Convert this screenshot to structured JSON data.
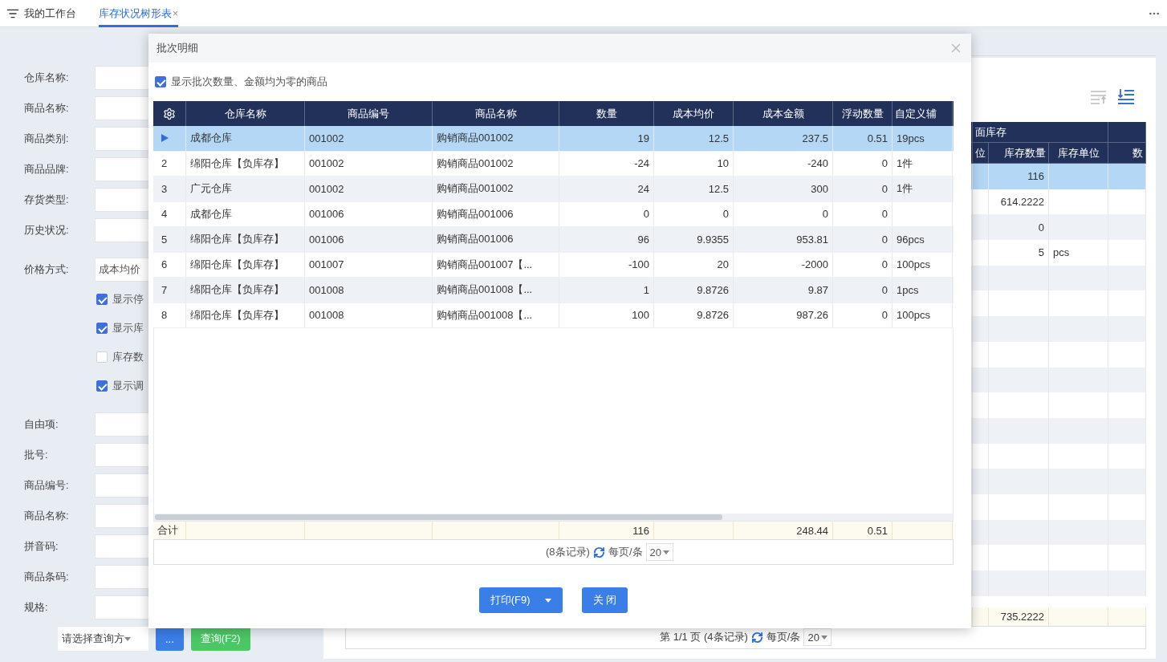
{
  "top_bar": {
    "home": "我的工作台",
    "tabs": [
      {
        "label": "库存状况树形表",
        "selected": true,
        "close": "×"
      }
    ]
  },
  "filter_form": {
    "sections": [
      {
        "fields": [
          {
            "kind": "input",
            "label": "仓库名称:"
          },
          {
            "kind": "input",
            "label": "商品名称:"
          },
          {
            "kind": "input",
            "label": "商品类别:"
          },
          {
            "kind": "input",
            "label": "商品品牌:"
          },
          {
            "kind": "input",
            "label": "存货类型:"
          },
          {
            "kind": "input",
            "label": "历史状况:"
          }
        ]
      },
      {
        "fields": [
          {
            "kind": "select",
            "label": "价格方式:",
            "value": "成本均价"
          },
          {
            "kind": "checkbox",
            "label": "显示停",
            "checked": true
          },
          {
            "kind": "checkbox",
            "label": "显示库",
            "checked": true
          },
          {
            "kind": "checkbox",
            "label": "库存数",
            "checked": false
          },
          {
            "kind": "checkbox",
            "label": "显示调",
            "checked": true
          }
        ]
      },
      {
        "fields": [
          {
            "kind": "input",
            "label": "自由项:"
          },
          {
            "kind": "input",
            "label": "批号:"
          },
          {
            "kind": "input",
            "label": "商品编号:"
          },
          {
            "kind": "input",
            "label": "商品名称:"
          },
          {
            "kind": "input",
            "label": "拼音码:"
          },
          {
            "kind": "input",
            "label": "商品条码:"
          },
          {
            "kind": "input",
            "label": "规格:"
          }
        ]
      }
    ]
  },
  "query_bar": {
    "mode_select": "请选择查询方",
    "more_button": "...",
    "query_button": "查询(F2)"
  },
  "report": {
    "group_header": "面库存",
    "columns": [
      {
        "label": "位",
        "kind": "text"
      },
      {
        "label": "库存数量",
        "kind": "number",
        "total": "735.2222"
      },
      {
        "label": "库存单位",
        "kind": "text"
      },
      {
        "label": "数",
        "kind": "number"
      }
    ],
    "rows": [
      {
        "selected": true,
        "qty": "116"
      },
      {
        "selected": false,
        "qty": "614.2222"
      },
      {
        "selected": false,
        "qty": "0"
      },
      {
        "selected": false,
        "qty": "5",
        "unit": "pcs"
      }
    ],
    "pager": {
      "info": "第 1/1 页 (4条记录)",
      "per_page_label": "每页/条",
      "per_page": "20"
    }
  },
  "dialog": {
    "title": "批次明细",
    "show_zero": {
      "label": "显示批次数量、金额均为零的商品",
      "checked": true
    },
    "columns": [
      {
        "label": "仓库名称",
        "kind": "text"
      },
      {
        "label": "商品编号",
        "kind": "text"
      },
      {
        "label": "商品名称",
        "kind": "text"
      },
      {
        "label": "数量",
        "kind": "number",
        "total": "116"
      },
      {
        "label": "成本均价",
        "kind": "number"
      },
      {
        "label": "成本金额",
        "kind": "number",
        "total": "248.44"
      },
      {
        "label": "浮动数量",
        "kind": "number",
        "total": "0.51"
      },
      {
        "label": "自定义辅",
        "kind": "text"
      }
    ],
    "rows": [
      {
        "selected": true,
        "cells": [
          "成都仓库",
          "001002",
          "购销商品001002",
          "19",
          "12.5",
          "237.5",
          "0.51",
          "19pcs"
        ]
      },
      {
        "index": "2",
        "selected": false,
        "cells": [
          "绵阳仓库【负库存】",
          "001002",
          "购销商品001002",
          "-24",
          "10",
          "-240",
          "0",
          "1件"
        ]
      },
      {
        "index": "3",
        "selected": false,
        "cells": [
          "广元仓库",
          "001002",
          "购销商品001002",
          "24",
          "12.5",
          "300",
          "0",
          "1件"
        ]
      },
      {
        "index": "4",
        "selected": false,
        "cells": [
          "成都仓库",
          "001006",
          "购销商品001006",
          "0",
          "0",
          "0",
          "0"
        ]
      },
      {
        "index": "5",
        "selected": false,
        "cells": [
          "绵阳仓库【负库存】",
          "001006",
          "购销商品001006",
          "96",
          "9.9355",
          "953.81",
          "0",
          "96pcs"
        ]
      },
      {
        "index": "6",
        "selected": false,
        "cells": [
          "绵阳仓库【负库存】",
          "001007",
          "购销商品001007【...",
          "-100",
          "20",
          "-2000",
          "0",
          "100pcs"
        ]
      },
      {
        "index": "7",
        "selected": false,
        "cells": [
          "绵阳仓库【负库存】",
          "001008",
          "购销商品001008【...",
          "1",
          "9.8726",
          "9.87",
          "0",
          "1pcs"
        ]
      },
      {
        "index": "8",
        "selected": false,
        "cells": [
          "绵阳仓库【负库存】",
          "001008",
          "购销商品001008【...",
          "100",
          "9.8726",
          "987.26",
          "0",
          "100pcs"
        ]
      }
    ],
    "totals_label": "合计",
    "pager": {
      "info": "(8条记录)",
      "per_page_label": "每页/条",
      "per_page": "20"
    },
    "buttons": [
      {
        "label": "打印(F9)",
        "kind": "split"
      },
      {
        "label": "关 闭",
        "kind": "plain"
      }
    ]
  }
}
